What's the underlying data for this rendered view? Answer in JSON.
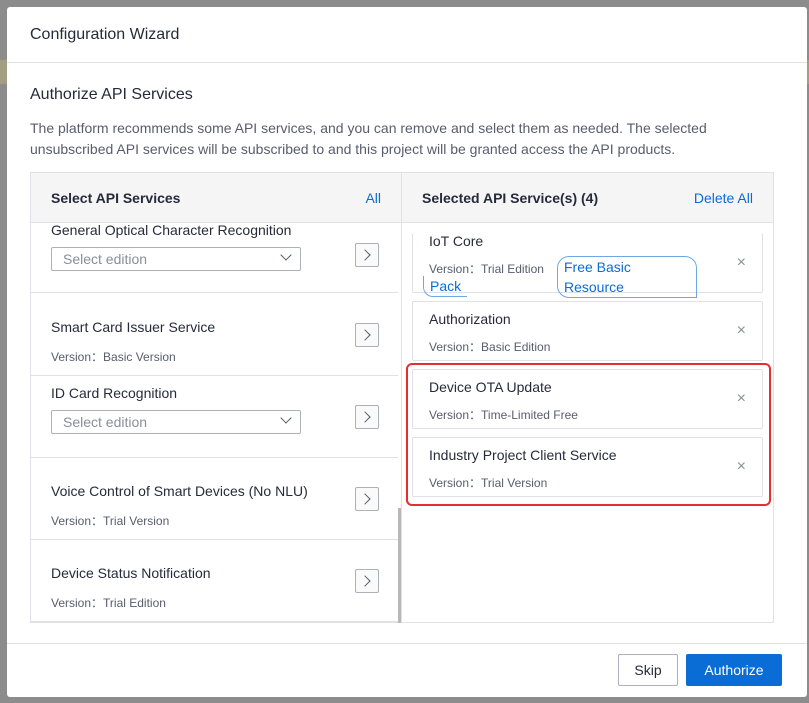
{
  "dialog": {
    "title": "Configuration Wizard",
    "section_title": "Authorize API Services",
    "description": "The platform recommends some API services, and you can remove and select them as needed. The selected unsubscribed API services will be subscribed to and this project will be granted access the API products."
  },
  "left_panel": {
    "title": "Select API Services",
    "all_link": "All",
    "items": [
      {
        "name": "General Optical Character Recognition",
        "select_placeholder": "Select edition"
      },
      {
        "name": "Smart Card Issuer Service",
        "version": "Version：Basic Version"
      },
      {
        "name": "ID Card Recognition",
        "select_placeholder": "Select edition"
      },
      {
        "name": "Voice Control of Smart Devices (No NLU)",
        "version": "Version：Trial Version"
      },
      {
        "name": "Device Status Notification",
        "version": "Version：Trial Edition"
      }
    ]
  },
  "right_panel": {
    "title": "Selected API Service(s) (4)",
    "delete_all": "Delete All",
    "items": [
      {
        "name": "IoT Core",
        "version": "Version：Trial Edition",
        "tag_line1": "Free Basic Resource",
        "tag_line2": "Pack"
      },
      {
        "name": "Authorization",
        "version": "Version：Basic Edition"
      },
      {
        "name": "Device OTA Update",
        "version": "Version：Time-Limited Free"
      },
      {
        "name": "Industry Project Client Service",
        "version": "Version：Trial Version"
      }
    ],
    "close_glyph": "×"
  },
  "footer": {
    "skip_label": "Skip",
    "authorize_label": "Authorize"
  },
  "colors": {
    "primary": "#0a6cd5",
    "highlight": "#e52e2e"
  }
}
